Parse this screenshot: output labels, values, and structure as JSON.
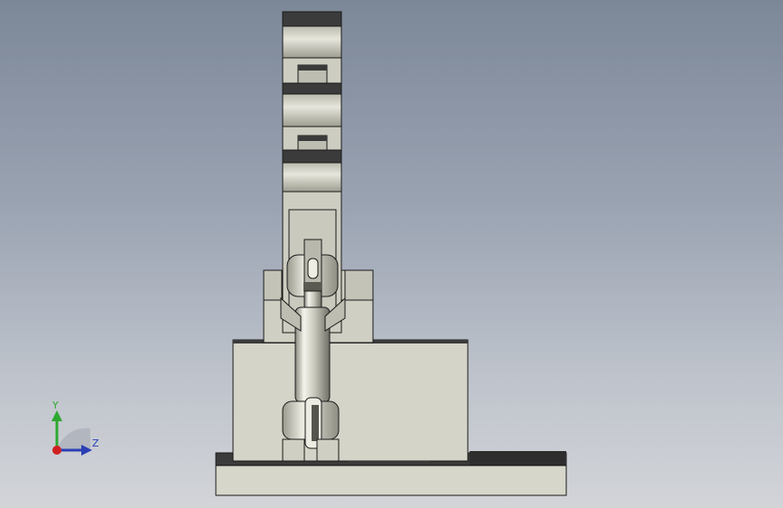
{
  "viewport": {
    "background_top": "#7c8798",
    "background_bottom": "#d2d4d8"
  },
  "model": {
    "name": "",
    "fill_light": "#d8d8cc",
    "fill_mid": "#c7c7ba",
    "fill_shadow": "#a9a99c",
    "edge_color": "#1a1a1a",
    "dark_band": "#3b3b3b"
  },
  "triad": {
    "y_label": "Y",
    "z_label": "Z",
    "y_color": "#2fa82f",
    "z_color": "#2a3fb5",
    "x_color": "#d02020"
  }
}
